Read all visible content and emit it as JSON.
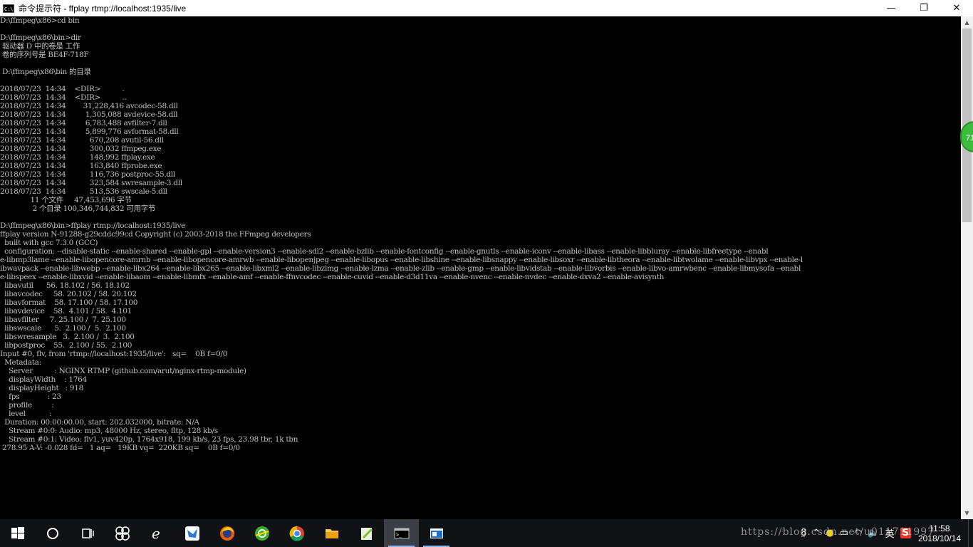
{
  "window": {
    "icon_text": "C:\\",
    "title": "命令提示符 - ffplay  rtmp://localhost:1935/live",
    "minimize": "—",
    "maximize": "❐",
    "close": "✕"
  },
  "console": {
    "lines": [
      "D:\\ffmpeg\\x86>cd bin",
      "",
      "D:\\ffmpeg\\x86\\bin>dir",
      " 驱动器 D 中的卷是 工作",
      " 卷的序列号是 BE4F-718F",
      "",
      " D:\\ffmpeg\\x86\\bin 的目录",
      "",
      "2018/07/23  14:34    <DIR>          .",
      "2018/07/23  14:34    <DIR>          ..",
      "2018/07/23  14:34        31,228,416 avcodec-58.dll",
      "2018/07/23  14:34         1,305,088 avdevice-58.dll",
      "2018/07/23  14:34         6,783,488 avfilter-7.dll",
      "2018/07/23  14:34         5,899,776 avformat-58.dll",
      "2018/07/23  14:34           670,208 avutil-56.dll",
      "2018/07/23  14:34           300,032 ffmpeg.exe",
      "2018/07/23  14:34           148,992 ffplay.exe",
      "2018/07/23  14:34           163,840 ffprobe.exe",
      "2018/07/23  14:34           116,736 postproc-55.dll",
      "2018/07/23  14:34           323,584 swresample-3.dll",
      "2018/07/23  14:34           513,536 swscale-5.dll",
      "              11 个文件     47,453,696 字节",
      "               2 个目录 100,346,744,832 可用字节",
      "",
      "D:\\ffmpeg\\x86\\bin>ffplay rtmp://localhost:1935/live",
      "ffplay version N-91288-g29cddc99cd Copyright (c) 2003-2018 the FFmpeg developers",
      "  built with gcc 7.3.0 (GCC)",
      "  configuration: --disable-static --enable-shared --enable-gpl --enable-version3 --enable-sdl2 --enable-bzlib --enable-fontconfig --enable-gnutls --enable-iconv --enable-libass --enable-libbluray --enable-libfreetype --enabl",
      "e-libmp3lame --enable-libopencore-amrnb --enable-libopencore-amrwb --enable-libopenjpeg --enable-libopus --enable-libshine --enable-libsnappy --enable-libsoxr --enable-libtheora --enable-libtwolame --enable-libvpx --enable-l",
      "ibwavpack --enable-libwebp --enable-libx264 --enable-libx265 --enable-libxml2 --enable-libzimg --enable-lzma --enable-zlib --enable-gmp --enable-libvidstab --enable-libvorbis --enable-libvo-amrwbenc --enable-libmysofa --enabl",
      "e-libspeex --enable-libxvid --enable-libaom --enable-libmfx --enable-amf --enable-ffnvcodec --enable-cuvid --enable-d3d11va --enable-nvenc --enable-nvdec --enable-dxva2 --enable-avisynth",
      "  libavutil      56. 18.102 / 56. 18.102",
      "  libavcodec     58. 20.102 / 58. 20.102",
      "  libavformat    58. 17.100 / 58. 17.100",
      "  libavdevice    58.  4.101 / 58.  4.101",
      "  libavfilter     7. 25.100 /  7. 25.100",
      "  libswscale      5.  2.100 /  5.  2.100",
      "  libswresample   3.  2.100 /  3.  2.100",
      "  libpostproc    55.  2.100 / 55.  2.100",
      "Input #0, flv, from 'rtmp://localhost:1935/live':   sq=    0B f=0/0",
      "  Metadata:",
      "    Server          : NGINX RTMP (github.com/arut/nginx-rtmp-module)",
      "    displayWidth    : 1764",
      "    displayHeight   : 918",
      "    fps             : 23",
      "    profile         :",
      "    level           :",
      "  Duration: 00:00:00.00, start: 202.032000, bitrate: N/A",
      "    Stream #0:0: Audio: mp3, 48000 Hz, stereo, fltp, 128 kb/s",
      "    Stream #0:1: Video: flv1, yuv420p, 1764x918, 199 kb/s, 23 fps, 23.98 tbr, 1k tbn",
      " 278.95 A-V: -0.028 fd=   1 aq=   19KB vq=  220KB sq=    0B f=0/0"
    ]
  },
  "badge": {
    "text": "71"
  },
  "scrollbar": {
    "up": "▲",
    "down": "▼"
  },
  "taskbar": {
    "apps": [
      {
        "name": "start-button",
        "icon": "windows-icon"
      },
      {
        "name": "cortana-button",
        "icon": "cortana-icon"
      },
      {
        "name": "task-view-button",
        "icon": "task-view-icon"
      },
      {
        "name": "app-pinwheel",
        "icon": "pinwheel-icon"
      },
      {
        "name": "app-ie",
        "icon": "ie-icon"
      },
      {
        "name": "app-feishu",
        "icon": "feishu-icon"
      },
      {
        "name": "app-firefox",
        "icon": "firefox-icon"
      },
      {
        "name": "app-360-browser",
        "icon": "360-browser-icon"
      },
      {
        "name": "app-chrome",
        "icon": "chrome-icon"
      },
      {
        "name": "app-file-explorer",
        "icon": "folder-icon"
      },
      {
        "name": "app-notepad-plus",
        "icon": "notepad-icon"
      },
      {
        "name": "app-cmd",
        "icon": "cmd-icon"
      },
      {
        "name": "app-window",
        "icon": "window-icon"
      }
    ],
    "tray": {
      "people": "8",
      "ime": "英",
      "sougou": "S",
      "volume": "🔈",
      "time": "11:58",
      "date": "2018/10/14"
    },
    "watermark": "https://blog.csdn.net/u011711997"
  }
}
